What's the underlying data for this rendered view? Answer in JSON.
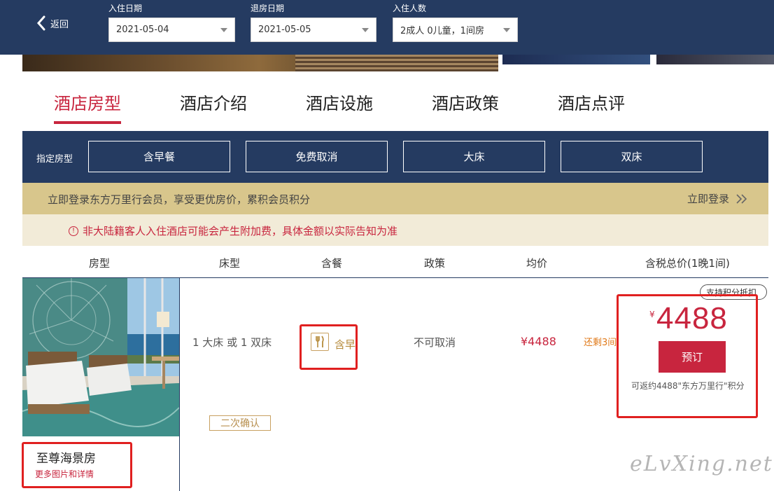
{
  "header": {
    "back_label": "返回",
    "checkin": {
      "label": "入住日期",
      "value": "2021-05-04"
    },
    "checkout": {
      "label": "退房日期",
      "value": "2021-05-05"
    },
    "guests": {
      "label": "入住人数",
      "value": "2成人 0儿童，1间房"
    }
  },
  "tabs": [
    {
      "label": "酒店房型",
      "active": true
    },
    {
      "label": "酒店介绍",
      "active": false
    },
    {
      "label": "酒店设施",
      "active": false
    },
    {
      "label": "酒店政策",
      "active": false
    },
    {
      "label": "酒店点评",
      "active": false
    }
  ],
  "filters": {
    "label": "指定房型",
    "chips": [
      "含早餐",
      "免费取消",
      "大床",
      "双床"
    ]
  },
  "member_banner": {
    "text": "立即登录东方万里行会员，享受更优房价，累积会员积分",
    "login_label": "立即登录"
  },
  "notice": {
    "text": "非大陆籍客人入住酒店可能会产生附加费，具体金额以实际告知为准"
  },
  "table_header": {
    "room_type": "房型",
    "bed_type": "床型",
    "meal": "含餐",
    "policy": "政策",
    "avg_price": "均价",
    "total_price": "含税总价(1晚1间)"
  },
  "room": {
    "name": "至尊海景房",
    "more_link": "更多图片和详情",
    "bed": "1 大床 或 1 双床",
    "meal": "含早",
    "policy": "不可取消",
    "avg_price": "¥4488",
    "remaining": "还剩3间",
    "confirm_tag": "二次确认",
    "points_tag": "支持积分抵扣",
    "currency": "¥",
    "total_price": "4488",
    "book_label": "预订",
    "points_note": "可返约4488\"东方万里行\"积分"
  },
  "watermark": "eLvXing.net",
  "colors": {
    "navy": "#253b61",
    "accent": "#c8253e",
    "gold": "#d8c68c",
    "highlight": "#e02020"
  }
}
